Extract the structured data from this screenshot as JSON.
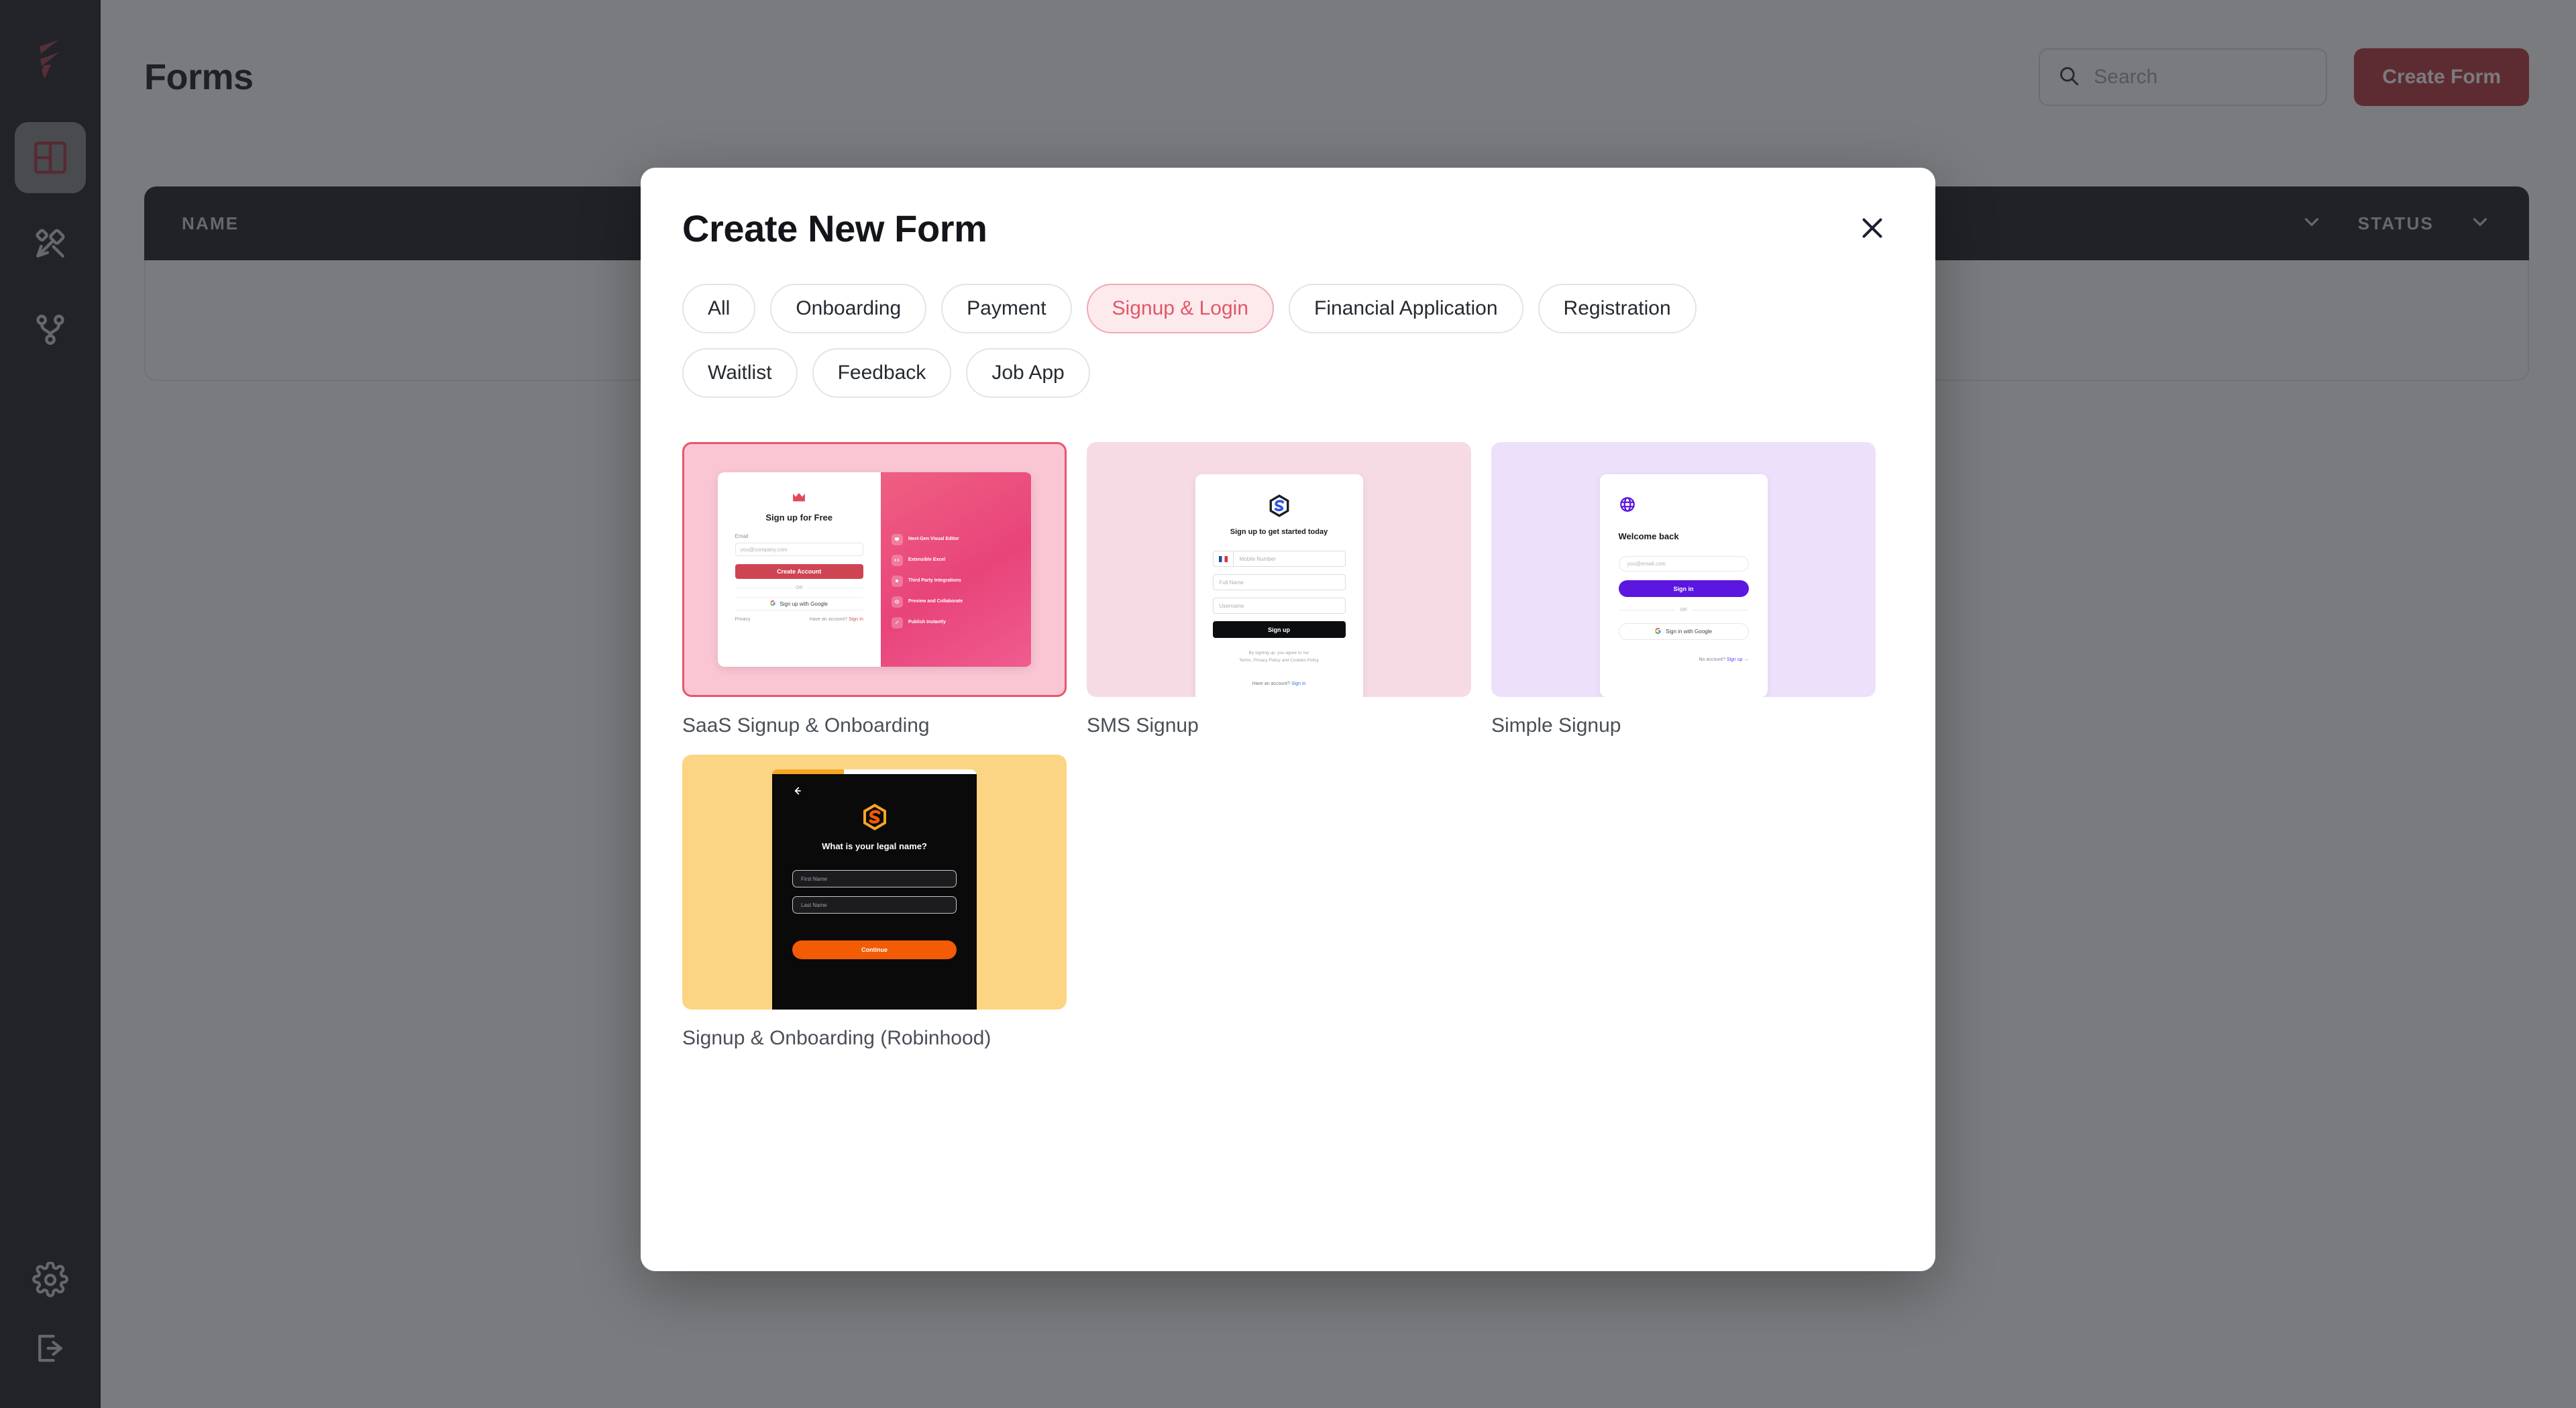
{
  "sidebar": {
    "logo_icon": "flame-logo-icon",
    "items": [
      {
        "name": "dashboard",
        "icon": "grid-dashboard-icon",
        "active": true
      },
      {
        "name": "design",
        "icon": "wand-cross-icon",
        "active": false
      },
      {
        "name": "workflows",
        "icon": "git-branch-icon",
        "active": false
      }
    ],
    "bottom_items": [
      {
        "name": "settings",
        "icon": "gear-icon"
      },
      {
        "name": "logout",
        "icon": "logout-arrow-icon"
      }
    ]
  },
  "header": {
    "title": "Forms",
    "search": {
      "placeholder": "Search",
      "value": "",
      "icon": "search-icon"
    },
    "create_button": "Create Form",
    "create_button_color": "#b3303c"
  },
  "table": {
    "columns": [
      {
        "label": "NAME"
      },
      {
        "label": "STATUS"
      }
    ],
    "chevron_icon": "chevron-down-icon",
    "rows": []
  },
  "modal": {
    "title": "Create New Form",
    "close_icon": "close-icon",
    "filters": [
      {
        "label": "All",
        "selected": false
      },
      {
        "label": "Onboarding",
        "selected": false
      },
      {
        "label": "Payment",
        "selected": false
      },
      {
        "label": "Signup & Login",
        "selected": true
      },
      {
        "label": "Financial Application",
        "selected": false
      },
      {
        "label": "Registration",
        "selected": false
      },
      {
        "label": "Waitlist",
        "selected": false
      },
      {
        "label": "Feedback",
        "selected": false
      },
      {
        "label": "Job App",
        "selected": false
      }
    ],
    "selected_filter": "Signup & Login",
    "selected_filter_color": "#e0586a",
    "templates": [
      {
        "label": "SaaS Signup & Onboarding",
        "selected": true,
        "preview": {
          "background": "#fbc6d4",
          "logo_icon": "crown-icon",
          "heading": "Sign up for Free",
          "field_label": "Email",
          "field_placeholder": "you@company.com",
          "primary_button": "Create Account",
          "divider": "OR",
          "google_button": "Sign up with Google",
          "footer_left": "Privacy",
          "footer_right": "Have an account?",
          "footer_link": "Sign In",
          "panel_color": "#e8447a",
          "features": [
            "Next-Gen Visual Editor",
            "Extensible Excel",
            "Third Party Integrations",
            "Preview and Collaborate",
            "Publish Instantly"
          ]
        }
      },
      {
        "label": "SMS Signup",
        "selected": false,
        "preview": {
          "background": "#f7dbe4",
          "logo_icon": "s-hexagon-icon",
          "heading": "Sign up to get started today",
          "phone_placeholder": "Mobile Number",
          "name_placeholder": "Full Name",
          "username_placeholder": "Username",
          "primary_button": "Sign up",
          "terms_line1": "By signing up, you agree to our",
          "terms_line2": "Terms, Privacy Policy and Cookies Policy",
          "footer_text": "Have an account?",
          "footer_link": "Sign in"
        }
      },
      {
        "label": "Simple Signup",
        "selected": false,
        "preview": {
          "background": "#ece0fb",
          "logo_icon": "globe-icon",
          "heading": "Welcome back",
          "email_placeholder": "you@email.com",
          "primary_button": "Sign in",
          "divider": "OR",
          "google_button": "Sign in with Google",
          "footer_text": "No account?",
          "footer_link": "Sign up →",
          "accent_color": "#5b16e0"
        }
      },
      {
        "label": "Signup & Onboarding (Robinhood)",
        "selected": false,
        "preview": {
          "background": "#fbd583",
          "progress_percent": 35,
          "back_icon": "arrow-left-icon",
          "logo_icon": "s-hexagon-orange-icon",
          "heading": "What is your legal name?",
          "first_name_placeholder": "First Name",
          "last_name_placeholder": "Last Name",
          "primary_button": "Continue",
          "accent_color": "#f35b04"
        }
      }
    ]
  }
}
